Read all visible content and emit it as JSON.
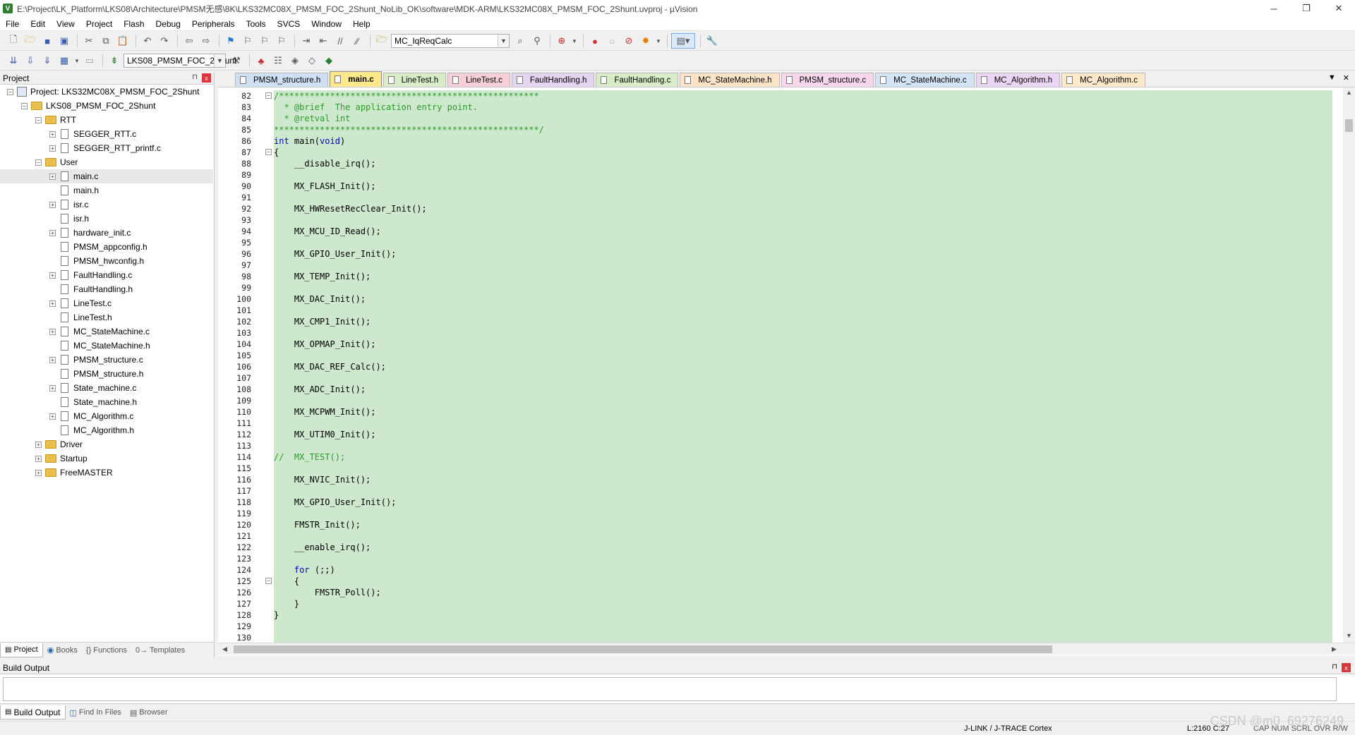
{
  "window": {
    "title": "E:\\Project\\LK_Platform\\LKS08\\Architecture\\PMSM无感\\8K\\LKS32MC08X_PMSM_FOC_2Shunt_NoLib_OK\\software\\MDK-ARM\\LKS32MC08X_PMSM_FOC_2Shunt.uvproj - µVision",
    "app_icon": "V",
    "controls": [
      "─",
      "❐",
      "✕"
    ]
  },
  "menu": [
    "File",
    "Edit",
    "View",
    "Project",
    "Flash",
    "Debug",
    "Peripherals",
    "Tools",
    "SVCS",
    "Window",
    "Help"
  ],
  "toolbar": {
    "find_combo": "MC_IqReqCalc",
    "target_combo": "LKS08_PMSM_FOC_2Shunt"
  },
  "project_panel": {
    "title": "Project",
    "pin": "⊓",
    "close": "x",
    "tree": [
      {
        "label": "Project: LKS32MC08X_PMSM_FOC_2Shunt",
        "type": "project",
        "level": 0,
        "exp": "−"
      },
      {
        "label": "LKS08_PMSM_FOC_2Shunt",
        "type": "folder",
        "level": 1,
        "exp": "−"
      },
      {
        "label": "RTT",
        "type": "folder",
        "level": 2,
        "exp": "−"
      },
      {
        "label": "SEGGER_RTT.c",
        "type": "file",
        "level": 3,
        "exp": "+"
      },
      {
        "label": "SEGGER_RTT_printf.c",
        "type": "file",
        "level": 3,
        "exp": "+"
      },
      {
        "label": "User",
        "type": "folder",
        "level": 2,
        "exp": "−"
      },
      {
        "label": "main.c",
        "type": "file",
        "level": 3,
        "exp": "+",
        "selected": true
      },
      {
        "label": "main.h",
        "type": "file",
        "level": 3,
        "exp": ""
      },
      {
        "label": "isr.c",
        "type": "file",
        "level": 3,
        "exp": "+"
      },
      {
        "label": "isr.h",
        "type": "file",
        "level": 3,
        "exp": ""
      },
      {
        "label": "hardware_init.c",
        "type": "file",
        "level": 3,
        "exp": "+"
      },
      {
        "label": "PMSM_appconfig.h",
        "type": "file",
        "level": 3,
        "exp": ""
      },
      {
        "label": "PMSM_hwconfig.h",
        "type": "file",
        "level": 3,
        "exp": ""
      },
      {
        "label": "FaultHandling.c",
        "type": "file",
        "level": 3,
        "exp": "+"
      },
      {
        "label": "FaultHandling.h",
        "type": "file",
        "level": 3,
        "exp": ""
      },
      {
        "label": "LineTest.c",
        "type": "file",
        "level": 3,
        "exp": "+"
      },
      {
        "label": "LineTest.h",
        "type": "file",
        "level": 3,
        "exp": ""
      },
      {
        "label": "MC_StateMachine.c",
        "type": "file",
        "level": 3,
        "exp": "+"
      },
      {
        "label": "MC_StateMachine.h",
        "type": "file",
        "level": 3,
        "exp": ""
      },
      {
        "label": "PMSM_structure.c",
        "type": "file",
        "level": 3,
        "exp": "+"
      },
      {
        "label": "PMSM_structure.h",
        "type": "file",
        "level": 3,
        "exp": ""
      },
      {
        "label": "State_machine.c",
        "type": "file",
        "level": 3,
        "exp": "+"
      },
      {
        "label": "State_machine.h",
        "type": "file",
        "level": 3,
        "exp": ""
      },
      {
        "label": "MC_Algorithm.c",
        "type": "file",
        "level": 3,
        "exp": "+"
      },
      {
        "label": "MC_Algorithm.h",
        "type": "file",
        "level": 3,
        "exp": ""
      },
      {
        "label": "Driver",
        "type": "folder",
        "level": 2,
        "exp": "+"
      },
      {
        "label": "Startup",
        "type": "folder",
        "level": 2,
        "exp": "+"
      },
      {
        "label": "FreeMASTER",
        "type": "folder",
        "level": 2,
        "exp": "+"
      }
    ],
    "tabs": [
      "Project",
      "Books",
      "{} Functions",
      "0→ Templates"
    ]
  },
  "editor": {
    "tabs": [
      {
        "label": "PMSM_structure.h",
        "color": "#cfe0f3",
        "active": false
      },
      {
        "label": "main.c",
        "color": "#ffe98a",
        "active": true
      },
      {
        "label": "LineTest.h",
        "color": "#d8ecc8",
        "active": false
      },
      {
        "label": "LineTest.c",
        "color": "#f7cfd8",
        "active": false
      },
      {
        "label": "FaultHandling.h",
        "color": "#e3d4f0",
        "active": false
      },
      {
        "label": "FaultHandling.c",
        "color": "#d8ecc8",
        "active": false
      },
      {
        "label": "MC_StateMachine.h",
        "color": "#fce3c6",
        "active": false
      },
      {
        "label": "PMSM_structure.c",
        "color": "#f7d6ea",
        "active": false
      },
      {
        "label": "MC_StateMachine.c",
        "color": "#d3e4f5",
        "active": false
      },
      {
        "label": "MC_Algorithm.h",
        "color": "#ead6f2",
        "active": false
      },
      {
        "label": "MC_Algorithm.c",
        "color": "#fde9c9",
        "active": false
      }
    ],
    "lines": [
      {
        "n": "82",
        "t": "/***************************************************",
        "c": "cm",
        "fold": "−"
      },
      {
        "n": "83",
        "t": "  * @brief  The application entry point.",
        "c": "cm"
      },
      {
        "n": "84",
        "t": "  * @retval int",
        "c": "cm"
      },
      {
        "n": "85",
        "t": "****************************************************/",
        "c": "cm"
      },
      {
        "n": "86",
        "t": "int main(void)",
        "c": "",
        "kw": "int"
      },
      {
        "n": "87",
        "t": "{",
        "c": "",
        "fold": "−"
      },
      {
        "n": "88",
        "t": "    __disable_irq();",
        "c": ""
      },
      {
        "n": "89",
        "t": "",
        "c": ""
      },
      {
        "n": "90",
        "t": "    MX_FLASH_Init();",
        "c": ""
      },
      {
        "n": "91",
        "t": "",
        "c": ""
      },
      {
        "n": "92",
        "t": "    MX_HWResetRecClear_Init();",
        "c": ""
      },
      {
        "n": "93",
        "t": "",
        "c": ""
      },
      {
        "n": "94",
        "t": "    MX_MCU_ID_Read();",
        "c": ""
      },
      {
        "n": "95",
        "t": "",
        "c": ""
      },
      {
        "n": "96",
        "t": "    MX_GPIO_User_Init();",
        "c": ""
      },
      {
        "n": "97",
        "t": "",
        "c": ""
      },
      {
        "n": "98",
        "t": "    MX_TEMP_Init();",
        "c": ""
      },
      {
        "n": "99",
        "t": "",
        "c": ""
      },
      {
        "n": "100",
        "t": "    MX_DAC_Init();",
        "c": ""
      },
      {
        "n": "101",
        "t": "",
        "c": ""
      },
      {
        "n": "102",
        "t": "    MX_CMP1_Init();",
        "c": ""
      },
      {
        "n": "103",
        "t": "",
        "c": ""
      },
      {
        "n": "104",
        "t": "    MX_OPMAP_Init();",
        "c": ""
      },
      {
        "n": "105",
        "t": "",
        "c": ""
      },
      {
        "n": "106",
        "t": "    MX_DAC_REF_Calc();",
        "c": ""
      },
      {
        "n": "107",
        "t": "",
        "c": ""
      },
      {
        "n": "108",
        "t": "    MX_ADC_Init();",
        "c": ""
      },
      {
        "n": "109",
        "t": "",
        "c": ""
      },
      {
        "n": "110",
        "t": "    MX_MCPWM_Init();",
        "c": ""
      },
      {
        "n": "111",
        "t": "",
        "c": ""
      },
      {
        "n": "112",
        "t": "    MX_UTIM0_Init();",
        "c": ""
      },
      {
        "n": "113",
        "t": "",
        "c": ""
      },
      {
        "n": "114",
        "t": "//  MX_TEST();",
        "c": "cm"
      },
      {
        "n": "115",
        "t": "",
        "c": ""
      },
      {
        "n": "116",
        "t": "    MX_NVIC_Init();",
        "c": ""
      },
      {
        "n": "117",
        "t": "",
        "c": ""
      },
      {
        "n": "118",
        "t": "    MX_GPIO_User_Init();",
        "c": ""
      },
      {
        "n": "119",
        "t": "",
        "c": ""
      },
      {
        "n": "120",
        "t": "    FMSTR_Init();",
        "c": ""
      },
      {
        "n": "121",
        "t": "",
        "c": ""
      },
      {
        "n": "122",
        "t": "    __enable_irq();",
        "c": ""
      },
      {
        "n": "123",
        "t": "",
        "c": ""
      },
      {
        "n": "124",
        "t": "    for (;;)",
        "c": "",
        "kw": "for"
      },
      {
        "n": "125",
        "t": "    {",
        "c": "",
        "fold": "−"
      },
      {
        "n": "126",
        "t": "        FMSTR_Poll();",
        "c": ""
      },
      {
        "n": "127",
        "t": "    }",
        "c": ""
      },
      {
        "n": "128",
        "t": "}",
        "c": ""
      },
      {
        "n": "129",
        "t": "",
        "c": ""
      },
      {
        "n": "130",
        "t": "",
        "c": ""
      }
    ]
  },
  "build_output": {
    "title": "Build Output",
    "tabs": [
      "Build Output",
      "Find In Files",
      "Browser"
    ]
  },
  "status": {
    "debugger": "J-LINK / J-TRACE Cortex",
    "position": "L:2160 C:27",
    "indicators": "CAP  NUM  SCRL  OVR  R/W"
  },
  "watermark": "CSDN @m0_69276249"
}
